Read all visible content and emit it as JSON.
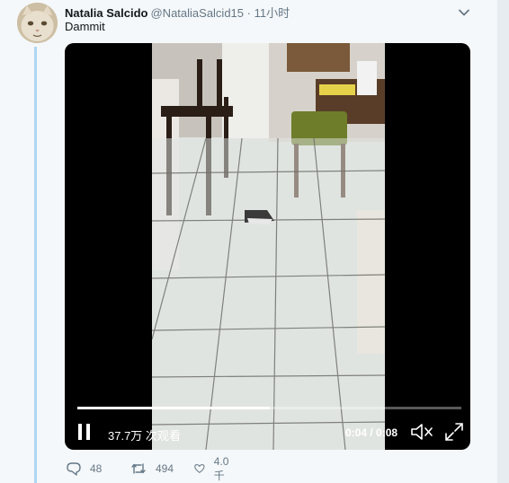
{
  "tweet": {
    "author_name": "Natalia Salcido",
    "handle_time": "@NataliaSalcid15 · 11小时",
    "text": "Dammit",
    "icons": {
      "menu": "chevron-down-icon",
      "avatar": "cat-avatar"
    }
  },
  "video": {
    "views": "37.7万 次观看",
    "time": "0:04 / 0:08",
    "progress": 0.5,
    "state": "playing",
    "icons": [
      "pause-icon",
      "mute-icon",
      "fullscreen-icon"
    ]
  },
  "actions": {
    "replies": "48",
    "retweets": "494",
    "likes": "4.0千",
    "icons": [
      "reply-icon",
      "retweet-icon",
      "like-icon"
    ]
  },
  "colors": {
    "accent": "#1da1f2",
    "thread_line": "#aed7f3",
    "meta_text": "#657786"
  }
}
